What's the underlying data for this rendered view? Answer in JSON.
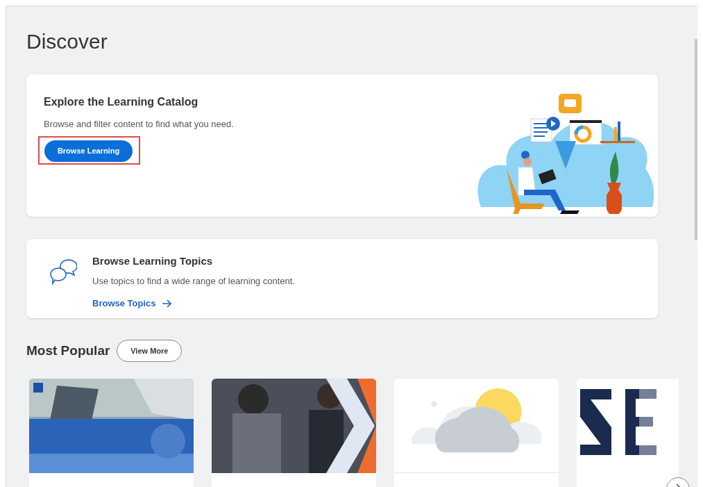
{
  "page_title": "Discover",
  "catalog": {
    "title": "Explore the Learning Catalog",
    "description": "Browse and filter content to find what you need.",
    "button": "Browse Learning",
    "highlighted": true
  },
  "topics": {
    "title": "Browse Learning Topics",
    "description": "Use topics to find a wide range of learning content.",
    "link": "Browse Topics"
  },
  "most_popular": {
    "title": "Most Popular",
    "button": "View More",
    "cards": [
      {
        "kind": "picture"
      },
      {
        "kind": "picture"
      },
      {
        "kind": "cloud"
      },
      {
        "kind": "picture"
      }
    ]
  }
}
